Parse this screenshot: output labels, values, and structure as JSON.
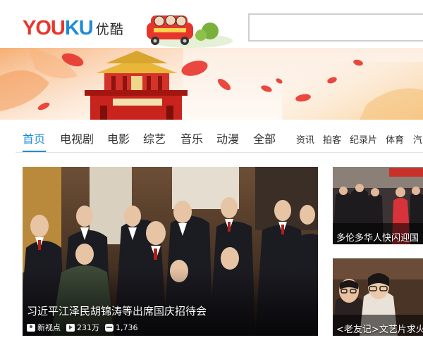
{
  "header": {
    "logo_text": "YOUKU",
    "logo_cn": "优酷",
    "search": {
      "value": "",
      "placeholder": ""
    }
  },
  "nav": {
    "primary": [
      "首页",
      "电视剧",
      "电影",
      "综艺",
      "音乐",
      "动漫",
      "全部"
    ],
    "secondary": [
      "资讯",
      "拍客",
      "纪录片",
      "体育",
      "汽"
    ],
    "active_index": 0
  },
  "feature": {
    "title": "习近平江泽民胡锦涛等出席国庆招待会",
    "channel": "新视点",
    "plays": "231万",
    "comments": "1,736"
  },
  "side_cards": [
    {
      "title": "多伦多华人快闪迎国"
    },
    {
      "title": "<老友记>文艺片求火"
    }
  ],
  "colors": {
    "brand_red": "#e8352c",
    "brand_blue": "#1f8bd8",
    "nav_active": "#1f8bd8"
  },
  "icons": [
    "search-icon",
    "user-icon",
    "play-icon",
    "comment-icon"
  ]
}
